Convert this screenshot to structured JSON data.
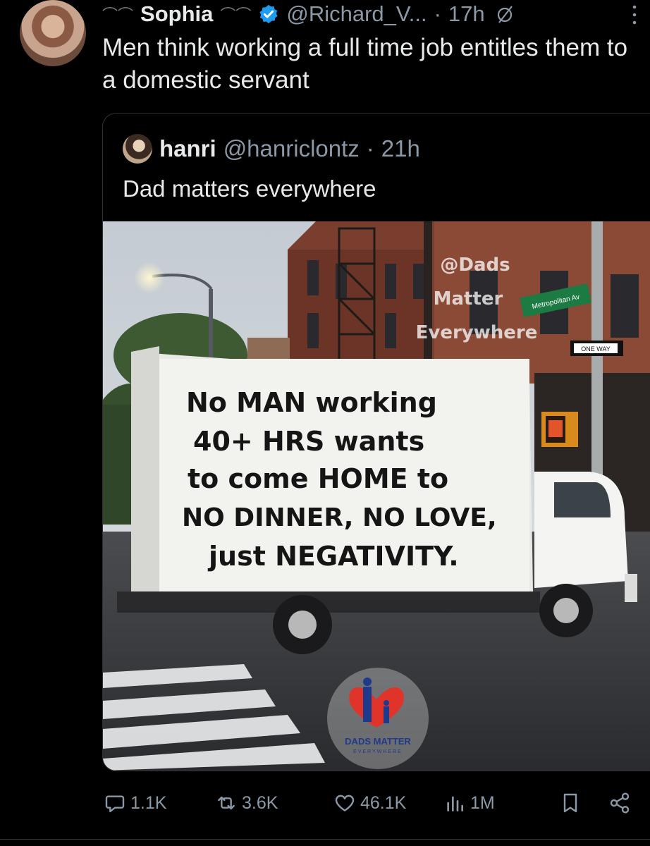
{
  "tweet": {
    "display_name": "Sophia",
    "name_flourish": "⌒⌒",
    "handle": "@Richard_V...",
    "separator": "·",
    "time": "17h",
    "text": "Men think working a full time job entitles them to a domestic servant",
    "avatar_icon": "avatar-photo-icon",
    "verified_icon": "verified-badge-icon",
    "mute_icon": "muted-icon",
    "more_icon": "more-options-icon"
  },
  "quote": {
    "display_name": "hanri",
    "handle": "@hanriclontz",
    "separator": "·",
    "time": "21h",
    "text": "Dad matters everywhere",
    "image": {
      "watermark_lines": [
        "@Dads",
        "Matter",
        "Everywhere"
      ],
      "street_sign": "Metropolitan Av",
      "oneway_sign": "ONE WAY",
      "truck_text_lines": [
        "No MAN working",
        "40+ HRS wants",
        "to come HOME to",
        "NO DINNER, NO LOVE,",
        "just NEGATIVITY."
      ],
      "logo_title": "DADS MATTER",
      "logo_subtitle": "EVERYWHERE"
    }
  },
  "actions": {
    "replies": "1.1K",
    "reposts": "3.6K",
    "likes": "46.1K",
    "views": "1M",
    "reply_icon": "reply-icon",
    "repost_icon": "repost-icon",
    "like_icon": "heart-icon",
    "views_icon": "views-bar-chart-icon",
    "bookmark_icon": "bookmark-icon",
    "share_icon": "share-icon"
  },
  "colors": {
    "background": "#000000",
    "text_primary": "#e7e9ea",
    "text_secondary": "#8b98a5",
    "verified": "#1d9bf0",
    "border": "#2f3336"
  }
}
